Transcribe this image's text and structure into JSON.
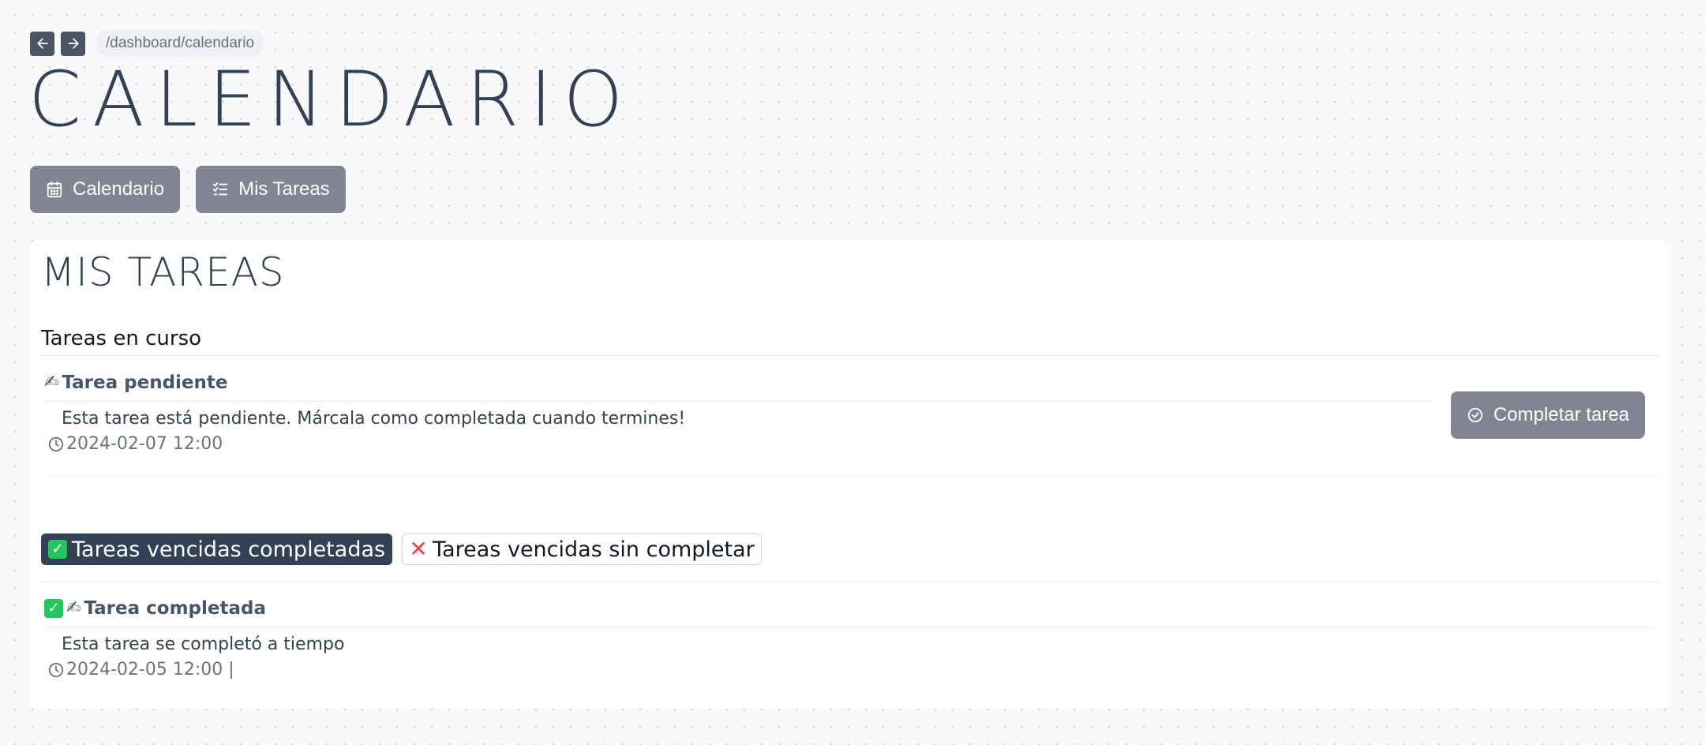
{
  "nav": {
    "back_icon": "arrow-left-icon",
    "forward_icon": "arrow-right-icon",
    "breadcrumb": "/dashboard/calendario"
  },
  "page": {
    "title": "CALENDARIO"
  },
  "tabs": [
    {
      "label": "Calendario",
      "icon": "calendar-icon"
    },
    {
      "label": "Mis Tareas",
      "icon": "checklist-icon"
    }
  ],
  "panel": {
    "title": "MIS TAREAS",
    "in_progress": {
      "heading": "Tareas en curso",
      "task": {
        "emoji": "✍",
        "title": "Tarea pendiente",
        "description": "Esta tarea está pendiente. Márcala como completada cuando termines!",
        "date": "2024-02-07 12:00",
        "complete_label": "Completar tarea"
      }
    },
    "filters": {
      "completed_label": "Tareas vencidas completadas",
      "not_completed_label": "Tareas vencidas sin completar"
    },
    "completed_task": {
      "check_emoji": "✓",
      "emoji": "✍",
      "title": "Tarea completada",
      "description": "Esta tarea se completó a tiempo",
      "date": "2024-02-05 12:00 |"
    }
  },
  "colors": {
    "primary_dark": "#334155",
    "button_gray": "#828591",
    "success_green": "#22c55e",
    "danger_red": "#ef4444"
  }
}
